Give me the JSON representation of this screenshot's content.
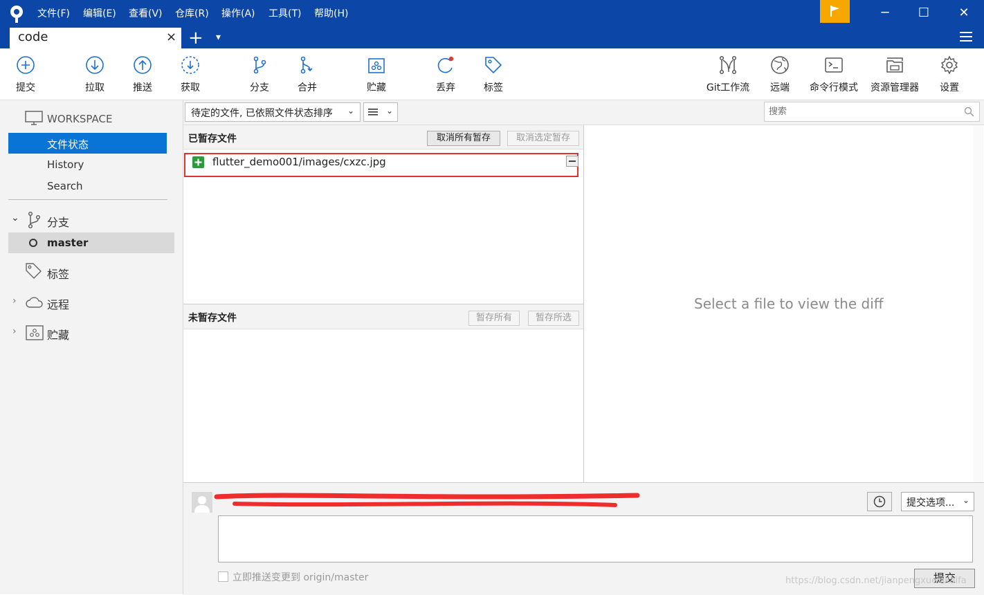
{
  "menu": [
    "文件(F)",
    "编辑(E)",
    "查看(V)",
    "仓库(R)",
    "操作(A)",
    "工具(T)",
    "帮助(H)"
  ],
  "tab": {
    "title": "code",
    "close": "×",
    "add": "+",
    "dropdown": "▾"
  },
  "toolbar": {
    "left": [
      {
        "label": "提交",
        "icon": "plus-circle-icon"
      },
      {
        "label": "拉取",
        "icon": "arrow-down-circle-icon"
      },
      {
        "label": "推送",
        "icon": "arrow-up-circle-icon"
      },
      {
        "label": "获取",
        "icon": "fetch-dashed-circle-icon"
      },
      {
        "label": "分支",
        "icon": "branch-icon"
      },
      {
        "label": "合并",
        "icon": "merge-icon"
      },
      {
        "label": "贮藏",
        "icon": "stash-icon"
      },
      {
        "label": "丢弃",
        "icon": "discard-icon"
      },
      {
        "label": "标签",
        "icon": "tag-icon"
      }
    ],
    "right": [
      {
        "label": "Git工作流",
        "icon": "git-flow-icon"
      },
      {
        "label": "远端",
        "icon": "globe-icon"
      },
      {
        "label": "命令行模式",
        "icon": "terminal-icon"
      },
      {
        "label": "资源管理器",
        "icon": "folder-icon"
      },
      {
        "label": "设置",
        "icon": "gear-icon"
      }
    ]
  },
  "sidebar": {
    "workspace": "WORKSPACE",
    "workspace_items": [
      "文件状态",
      "History",
      "Search"
    ],
    "branches": "分支",
    "branch_current": "master",
    "tags": "标签",
    "remotes": "远程",
    "stashes": "贮藏"
  },
  "filter": {
    "sort_label": "待定的文件, 已依照文件状态排序",
    "view_icon": "list-view-icon",
    "search_placeholder": "搜索"
  },
  "staged": {
    "title": "已暂存文件",
    "unstage_all": "取消所有暂存",
    "unstage_selected": "取消选定暂存",
    "files": [
      {
        "name": "flutter_demo001/images/cxzc.jpg",
        "status": "added"
      }
    ]
  },
  "unstaged": {
    "title": "未暂存文件",
    "stage_all": "暂存所有",
    "stage_selected": "暂存所选"
  },
  "diff": {
    "placeholder": "Select a file to view the diff"
  },
  "commit": {
    "options_label": "提交选项...",
    "push_checkbox_label": "立即推送变更到 origin/master",
    "submit_label": "提交"
  },
  "watermark": "https://blog.csdn.net/jianpengxuexikaifa",
  "colors": {
    "titlebar": "#0c47a8",
    "accent": "#0a74d6",
    "selected_bg": "#0a74d6",
    "flag": "#f6a800",
    "highlight_box": "#e03030"
  }
}
